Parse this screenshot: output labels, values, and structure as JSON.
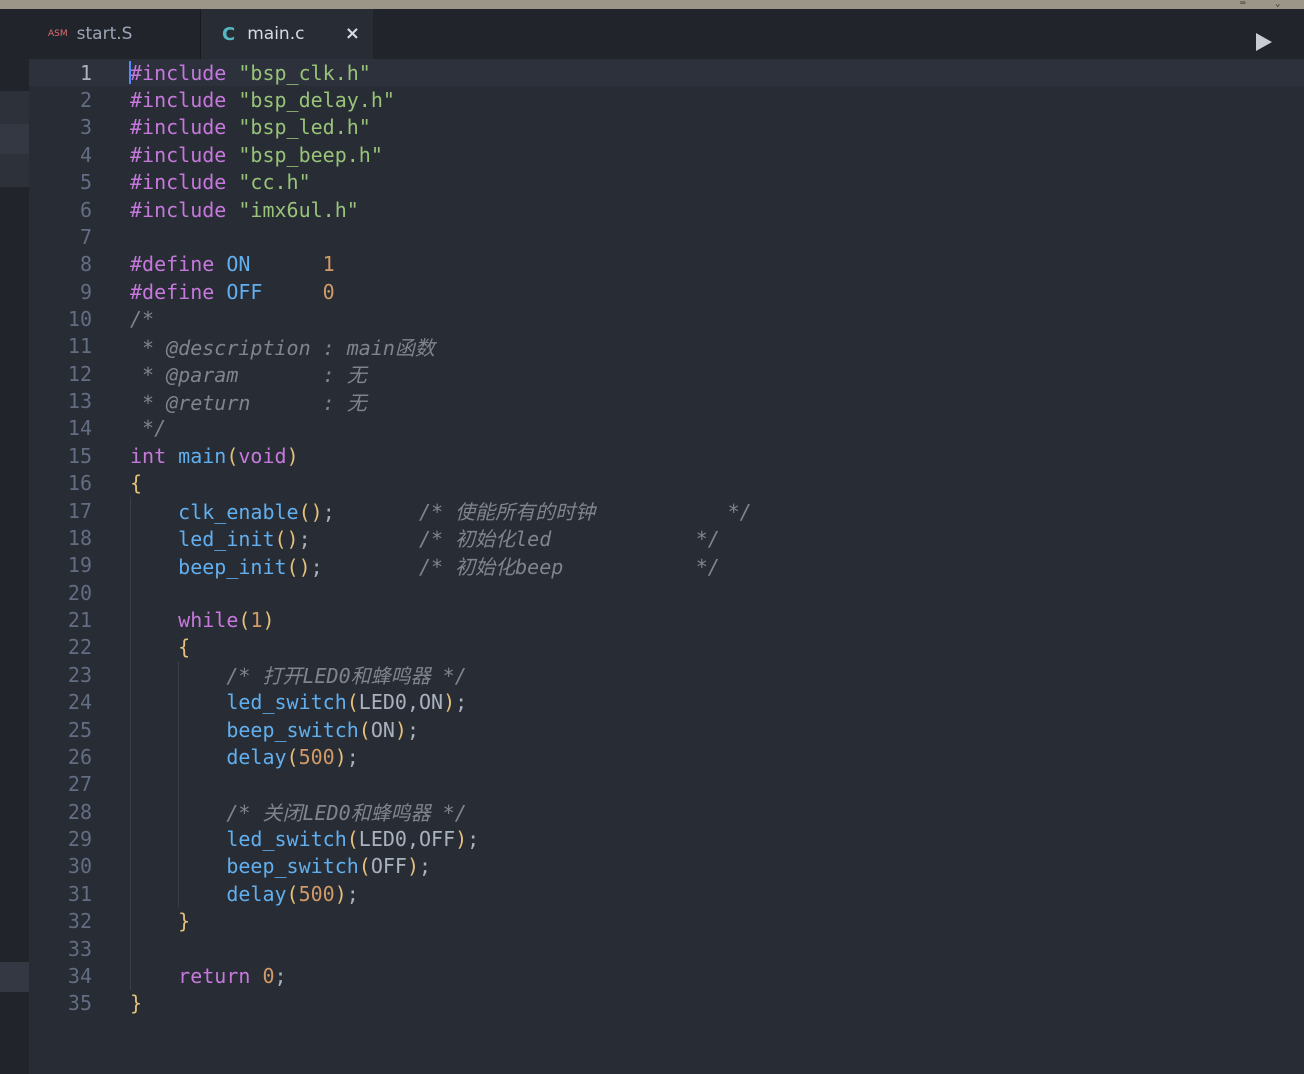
{
  "tabs": [
    {
      "icon": "ASM",
      "label": "start.S",
      "active": false
    },
    {
      "icon": "C",
      "label": "main.c",
      "active": true,
      "close": "×"
    }
  ],
  "editor": {
    "language": "c",
    "cursor_line": 1,
    "lines": [
      [
        [
          "#include ",
          "k"
        ],
        [
          "\"bsp_clk.h\"",
          "s"
        ]
      ],
      [
        [
          "#include ",
          "k"
        ],
        [
          "\"bsp_delay.h\"",
          "s"
        ]
      ],
      [
        [
          "#include ",
          "k"
        ],
        [
          "\"bsp_led.h\"",
          "s"
        ]
      ],
      [
        [
          "#include ",
          "k"
        ],
        [
          "\"bsp_beep.h\"",
          "s"
        ]
      ],
      [
        [
          "#include ",
          "k"
        ],
        [
          "\"cc.h\"",
          "s"
        ]
      ],
      [
        [
          "#include ",
          "k"
        ],
        [
          "\"imx6ul.h\"",
          "s"
        ]
      ],
      [],
      [
        [
          "#define ",
          "k"
        ],
        [
          "ON",
          "f"
        ],
        [
          "      ",
          "p"
        ],
        [
          "1",
          "n"
        ]
      ],
      [
        [
          "#define ",
          "k"
        ],
        [
          "OFF",
          "f"
        ],
        [
          "     ",
          "p"
        ],
        [
          "0",
          "n"
        ]
      ],
      [
        [
          "/*",
          "c"
        ]
      ],
      [
        [
          " * @description : main函数",
          "c"
        ]
      ],
      [
        [
          " * @param       : 无",
          "c"
        ]
      ],
      [
        [
          " * @return      : 无",
          "c"
        ]
      ],
      [
        [
          " */",
          "c"
        ]
      ],
      [
        [
          "int ",
          "k"
        ],
        [
          "main",
          "f"
        ],
        [
          "(",
          "v"
        ],
        [
          "void",
          "k"
        ],
        [
          ")",
          "v"
        ]
      ],
      [
        [
          "{",
          "v"
        ]
      ],
      [
        [
          "    ",
          "p"
        ],
        [
          "clk_enable",
          "f"
        ],
        [
          "()",
          "v"
        ],
        [
          ";",
          "p"
        ],
        [
          "       ",
          "p"
        ],
        [
          "/* 使能所有的时钟           */",
          "c"
        ]
      ],
      [
        [
          "    ",
          "p"
        ],
        [
          "led_init",
          "f"
        ],
        [
          "()",
          "v"
        ],
        [
          ";",
          "p"
        ],
        [
          "         ",
          "p"
        ],
        [
          "/* 初始化led            */",
          "c"
        ]
      ],
      [
        [
          "    ",
          "p"
        ],
        [
          "beep_init",
          "f"
        ],
        [
          "()",
          "v"
        ],
        [
          ";",
          "p"
        ],
        [
          "        ",
          "p"
        ],
        [
          "/* 初始化beep           */",
          "c"
        ]
      ],
      [],
      [
        [
          "    ",
          "p"
        ],
        [
          "while",
          "k"
        ],
        [
          "(",
          "v"
        ],
        [
          "1",
          "n"
        ],
        [
          ")",
          "v"
        ]
      ],
      [
        [
          "    ",
          "p"
        ],
        [
          "{",
          "v"
        ]
      ],
      [
        [
          "        ",
          "p"
        ],
        [
          "/* 打开LED0和蜂鸣器 */",
          "c"
        ]
      ],
      [
        [
          "        ",
          "p"
        ],
        [
          "led_switch",
          "f"
        ],
        [
          "(",
          "v"
        ],
        [
          "LED0,ON",
          "p"
        ],
        [
          ")",
          "v"
        ],
        [
          ";",
          "p"
        ]
      ],
      [
        [
          "        ",
          "p"
        ],
        [
          "beep_switch",
          "f"
        ],
        [
          "(",
          "v"
        ],
        [
          "ON",
          "p"
        ],
        [
          ")",
          "v"
        ],
        [
          ";",
          "p"
        ]
      ],
      [
        [
          "        ",
          "p"
        ],
        [
          "delay",
          "f"
        ],
        [
          "(",
          "v"
        ],
        [
          "500",
          "n"
        ],
        [
          ")",
          "v"
        ],
        [
          ";",
          "p"
        ]
      ],
      [],
      [
        [
          "        ",
          "p"
        ],
        [
          "/* 关闭LED0和蜂鸣器 */",
          "c"
        ]
      ],
      [
        [
          "        ",
          "p"
        ],
        [
          "led_switch",
          "f"
        ],
        [
          "(",
          "v"
        ],
        [
          "LED0,OFF",
          "p"
        ],
        [
          ")",
          "v"
        ],
        [
          ";",
          "p"
        ]
      ],
      [
        [
          "        ",
          "p"
        ],
        [
          "beep_switch",
          "f"
        ],
        [
          "(",
          "v"
        ],
        [
          "OFF",
          "p"
        ],
        [
          ")",
          "v"
        ],
        [
          ";",
          "p"
        ]
      ],
      [
        [
          "        ",
          "p"
        ],
        [
          "delay",
          "f"
        ],
        [
          "(",
          "v"
        ],
        [
          "500",
          "n"
        ],
        [
          ")",
          "v"
        ],
        [
          ";",
          "p"
        ]
      ],
      [
        [
          "    ",
          "p"
        ],
        [
          "}",
          "v"
        ]
      ],
      [],
      [
        [
          "    ",
          "p"
        ],
        [
          "return ",
          "k"
        ],
        [
          "0",
          "n"
        ],
        [
          ";",
          "p"
        ]
      ],
      [
        [
          "}",
          "v"
        ]
      ]
    ]
  },
  "theme": {
    "background": "#282c34",
    "keyword": "#c678dd",
    "string": "#98c379",
    "number": "#d19a66",
    "function": "#61afef",
    "comment": "#7f848e"
  }
}
